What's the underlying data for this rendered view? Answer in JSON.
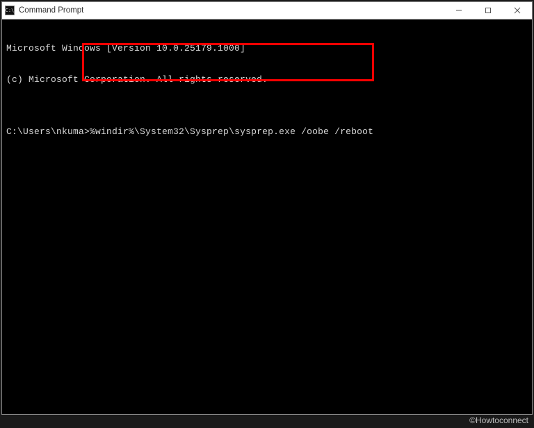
{
  "window": {
    "title": "Command Prompt",
    "icon_glyph": "C:\\"
  },
  "terminal": {
    "line1": "Microsoft Windows [Version 10.0.25179.1000]",
    "line2": "(c) Microsoft Corporation. All rights reserved.",
    "blank": "",
    "prompt": "C:\\Users\\nkuma>",
    "command": "%windir%\\System32\\Sysprep\\sysprep.exe /oobe /reboot"
  },
  "watermark": "©Howtoconnect"
}
